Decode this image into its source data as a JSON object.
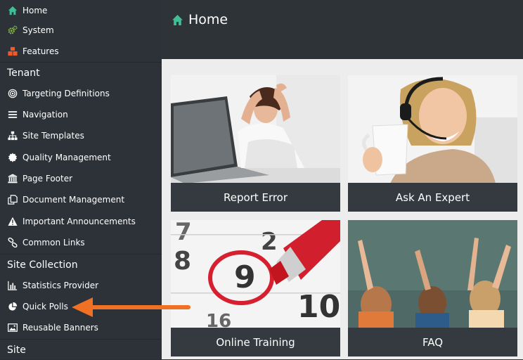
{
  "sidebar": {
    "top_items": [
      {
        "label": "Home",
        "icon": "home-icon"
      },
      {
        "label": "System",
        "icon": "cogs-icon"
      },
      {
        "label": "Features",
        "icon": "cubes-icon"
      }
    ],
    "sections": [
      {
        "title": "Tenant",
        "items": [
          {
            "label": "Targeting Definitions",
            "icon": "target-icon"
          },
          {
            "label": "Navigation",
            "icon": "menu-icon"
          },
          {
            "label": "Site Templates",
            "icon": "sitemap-icon"
          },
          {
            "label": "Quality Management",
            "icon": "badge-icon"
          },
          {
            "label": "Page Footer",
            "icon": "institution-icon"
          },
          {
            "label": "Document Management",
            "icon": "documents-icon"
          },
          {
            "label": "Important Announcements",
            "icon": "warning-icon"
          },
          {
            "label": "Common Links",
            "icon": "link-icon"
          }
        ]
      },
      {
        "title": "Site Collection",
        "items": [
          {
            "label": "Statistics Provider",
            "icon": "bar-chart-icon"
          },
          {
            "label": "Quick Polls",
            "icon": "pie-chart-icon"
          },
          {
            "label": "Reusable Banners",
            "icon": "image-icon"
          }
        ]
      },
      {
        "title": "Site",
        "items": []
      }
    ]
  },
  "header": {
    "title": "Home",
    "icon": "home-icon"
  },
  "tiles": [
    {
      "label": "Report Error"
    },
    {
      "label": "Ask An Expert"
    },
    {
      "label": "Online Training"
    },
    {
      "label": "FAQ"
    }
  ],
  "colors": {
    "sidebar_bg": "#2c3238",
    "header_bg": "#2e3338",
    "caption_bg": "#353a40",
    "accent_green": "#3fbf95",
    "system_icon": "#8cc63f",
    "features_icon": "#f05a28",
    "arrow": "#f07123"
  }
}
